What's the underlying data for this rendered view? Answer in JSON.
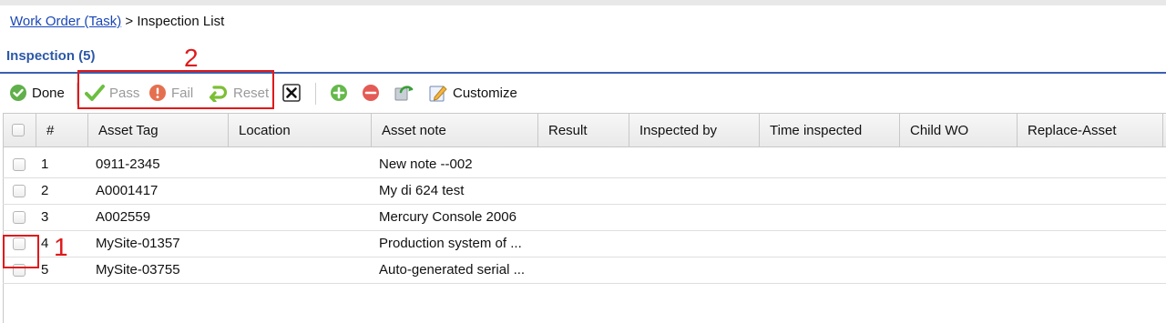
{
  "breadcrumb": {
    "link": "Work Order (Task)",
    "separator": " > ",
    "current": "Inspection List"
  },
  "section": {
    "title": "Inspection (5)"
  },
  "toolbar": {
    "done": "Done",
    "pass": "Pass",
    "fail": "Fail",
    "reset": "Reset",
    "customize": "Customize"
  },
  "annotations": {
    "box1": "1",
    "box2": "2"
  },
  "columns": [
    "#",
    "Asset Tag",
    "Location",
    "Asset note",
    "Result",
    "Inspected by",
    "Time inspected",
    "Child WO",
    "Replace-Asset"
  ],
  "rows": [
    {
      "num": "1",
      "asset_tag": "0911-2345",
      "location": "",
      "asset_note": "New note --002",
      "result": "",
      "inspected_by": "",
      "time_inspected": "",
      "child_wo": "",
      "replace_asset": ""
    },
    {
      "num": "2",
      "asset_tag": "A0001417",
      "location": "",
      "asset_note": "My di 624 test",
      "result": "",
      "inspected_by": "",
      "time_inspected": "",
      "child_wo": "",
      "replace_asset": ""
    },
    {
      "num": "3",
      "asset_tag": "A002559",
      "location": "",
      "asset_note": "Mercury Console 2006",
      "result": "",
      "inspected_by": "",
      "time_inspected": "",
      "child_wo": "",
      "replace_asset": ""
    },
    {
      "num": "4",
      "asset_tag": "MySite-01357",
      "location": "",
      "asset_note": "Production system of ...",
      "result": "",
      "inspected_by": "",
      "time_inspected": "",
      "child_wo": "",
      "replace_asset": ""
    },
    {
      "num": "5",
      "asset_tag": "MySite-03755",
      "location": "",
      "asset_note": "Auto-generated serial ...",
      "result": "",
      "inspected_by": "",
      "time_inspected": "",
      "child_wo": "",
      "replace_asset": ""
    }
  ],
  "colors": {
    "link": "#1a47b8",
    "title": "#2c58a8",
    "annotation": "#e0191b",
    "disabled_text": "#9a9a9a"
  },
  "icons": {
    "done": "check-circle-icon",
    "pass": "checkmark-icon",
    "fail": "exclamation-circle-icon",
    "reset": "undo-arrow-icon",
    "clear": "close-box-icon",
    "add": "plus-circle-icon",
    "remove": "minus-circle-icon",
    "refresh": "refresh-icon",
    "customize": "edit-pencil-icon"
  }
}
